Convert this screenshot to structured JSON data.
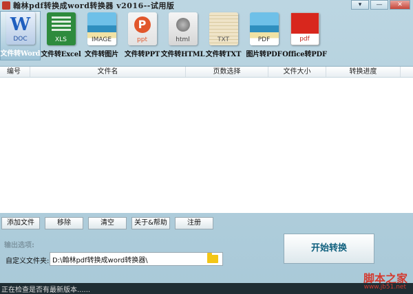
{
  "window": {
    "title": "翰林pdf转换成word转换器 v2016--试用版"
  },
  "toolbar": {
    "items": [
      {
        "label": "文件转Word",
        "icon_text": "DOC",
        "icon": "word-doc-icon"
      },
      {
        "label": "文件转Excel",
        "icon_text": "XLS",
        "icon": "excel-xls-icon"
      },
      {
        "label": "文件转图片",
        "icon_text": "IMAGE",
        "icon": "image-icon"
      },
      {
        "label": "文件转PPT",
        "icon_text": "ppt",
        "icon": "powerpoint-icon"
      },
      {
        "label": "文件转HTML",
        "icon_text": "html",
        "icon": "html-globe-icon"
      },
      {
        "label": "文件转TXT",
        "icon_text": "TXT",
        "icon": "text-file-icon"
      },
      {
        "label": "图片转PDF",
        "icon_text": "PDF",
        "icon": "image-to-pdf-icon"
      },
      {
        "label": "Office转PDF",
        "icon_text": "pdf",
        "icon": "acrobat-pdf-icon"
      }
    ]
  },
  "table": {
    "columns": [
      "编号",
      "文件名",
      "页数选择",
      "文件大小",
      "转换进度"
    ],
    "rows": []
  },
  "actions": {
    "add_file": "添加文件",
    "remove": "移除",
    "clear": "清空",
    "about_help": "关于&帮助",
    "register": "注册"
  },
  "output": {
    "section_title": "输出选项:",
    "folder_label": "自定义文件夹:",
    "folder_value": "D:\\翰林pdf转换成word转换器\\"
  },
  "start_button": "开始转换",
  "status": {
    "text": "正在检查是否有最新版本......"
  },
  "watermark": {
    "text": "脚本之家",
    "sub": "www.jb51.net"
  }
}
